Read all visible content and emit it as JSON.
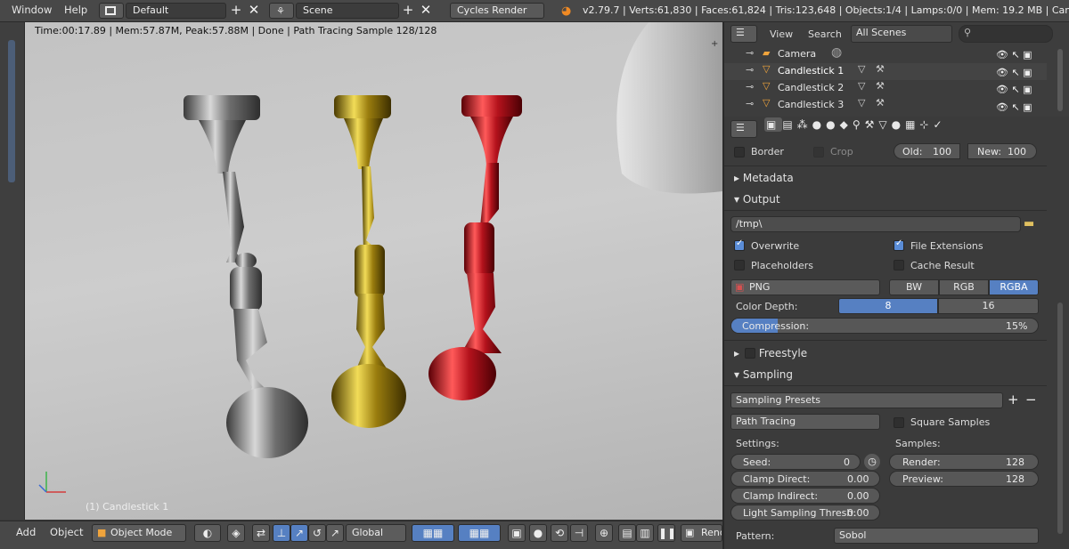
{
  "topbar": {
    "window_menu": "Window",
    "help_menu": "Help",
    "screen_layout": "Default",
    "scene": "Scene",
    "render_engine": "Cycles Render",
    "stats": "v2.79.7 | Verts:61,830 | Faces:61,824 | Tris:123,648 | Objects:1/4 | Lamps:0/0 | Mem: 19.2 MB | Candlestick"
  },
  "viewport": {
    "render_info": "Time:00:17.89 | Mem:57.87M, Peak:57.88M | Done | Path Tracing Sample 128/128",
    "object_label": "(1) Candlestick 1"
  },
  "bottombar": {
    "add_menu": "Add",
    "object_menu": "Object",
    "mode": "Object Mode",
    "orientation": "Global",
    "render_label": "Rend"
  },
  "outliner": {
    "view_menu": "View",
    "search_menu": "Search",
    "filter": "All Scenes",
    "items": [
      {
        "label": "Camera"
      },
      {
        "label": "Candlestick 1"
      },
      {
        "label": "Candlestick 2"
      },
      {
        "label": "Candlestick 3"
      }
    ]
  },
  "props": {
    "border_label": "Border",
    "crop_label": "Crop",
    "old_label": "Old:",
    "old_value": "100",
    "new_label": "New:",
    "new_value": "100",
    "metadata_label": "Metadata",
    "output_label": "Output",
    "output_path": "/tmp\\",
    "overwrite_label": "Overwrite",
    "file_ext_label": "File Extensions",
    "placeholders_label": "Placeholders",
    "cache_label": "Cache Result",
    "format": "PNG",
    "bw": "BW",
    "rgb": "RGB",
    "rgba": "RGBA",
    "color_depth_label": "Color Depth:",
    "depth_8": "8",
    "depth_16": "16",
    "compression_label": "Compression:",
    "compression_value": "15%",
    "compression_fraction": 0.15,
    "freestyle_label": "Freestyle",
    "sampling_label": "Sampling",
    "sampling_presets": "Sampling Presets",
    "integrator": "Path Tracing",
    "square_samples_label": "Square Samples",
    "settings_label": "Settings:",
    "samples_label": "Samples:",
    "seed_label": "Seed:",
    "seed_value": "0",
    "clamp_direct_label": "Clamp Direct:",
    "clamp_direct_value": "0.00",
    "clamp_indirect_label": "Clamp Indirect:",
    "clamp_indirect_value": "0.00",
    "light_thresh_label": "Light Sampling Thresh:",
    "light_thresh_value": "0.00",
    "render_label": "Render:",
    "render_value": "128",
    "preview_label": "Preview:",
    "preview_value": "128",
    "pattern_label": "Pattern:",
    "pattern_value": "Sobol"
  },
  "colors": {
    "accent": "#5680c2",
    "panel": "#3b3b3b",
    "candle_silver": "#9a9a9a",
    "candle_gold": "#b89a18",
    "candle_red": "#b4121c"
  }
}
